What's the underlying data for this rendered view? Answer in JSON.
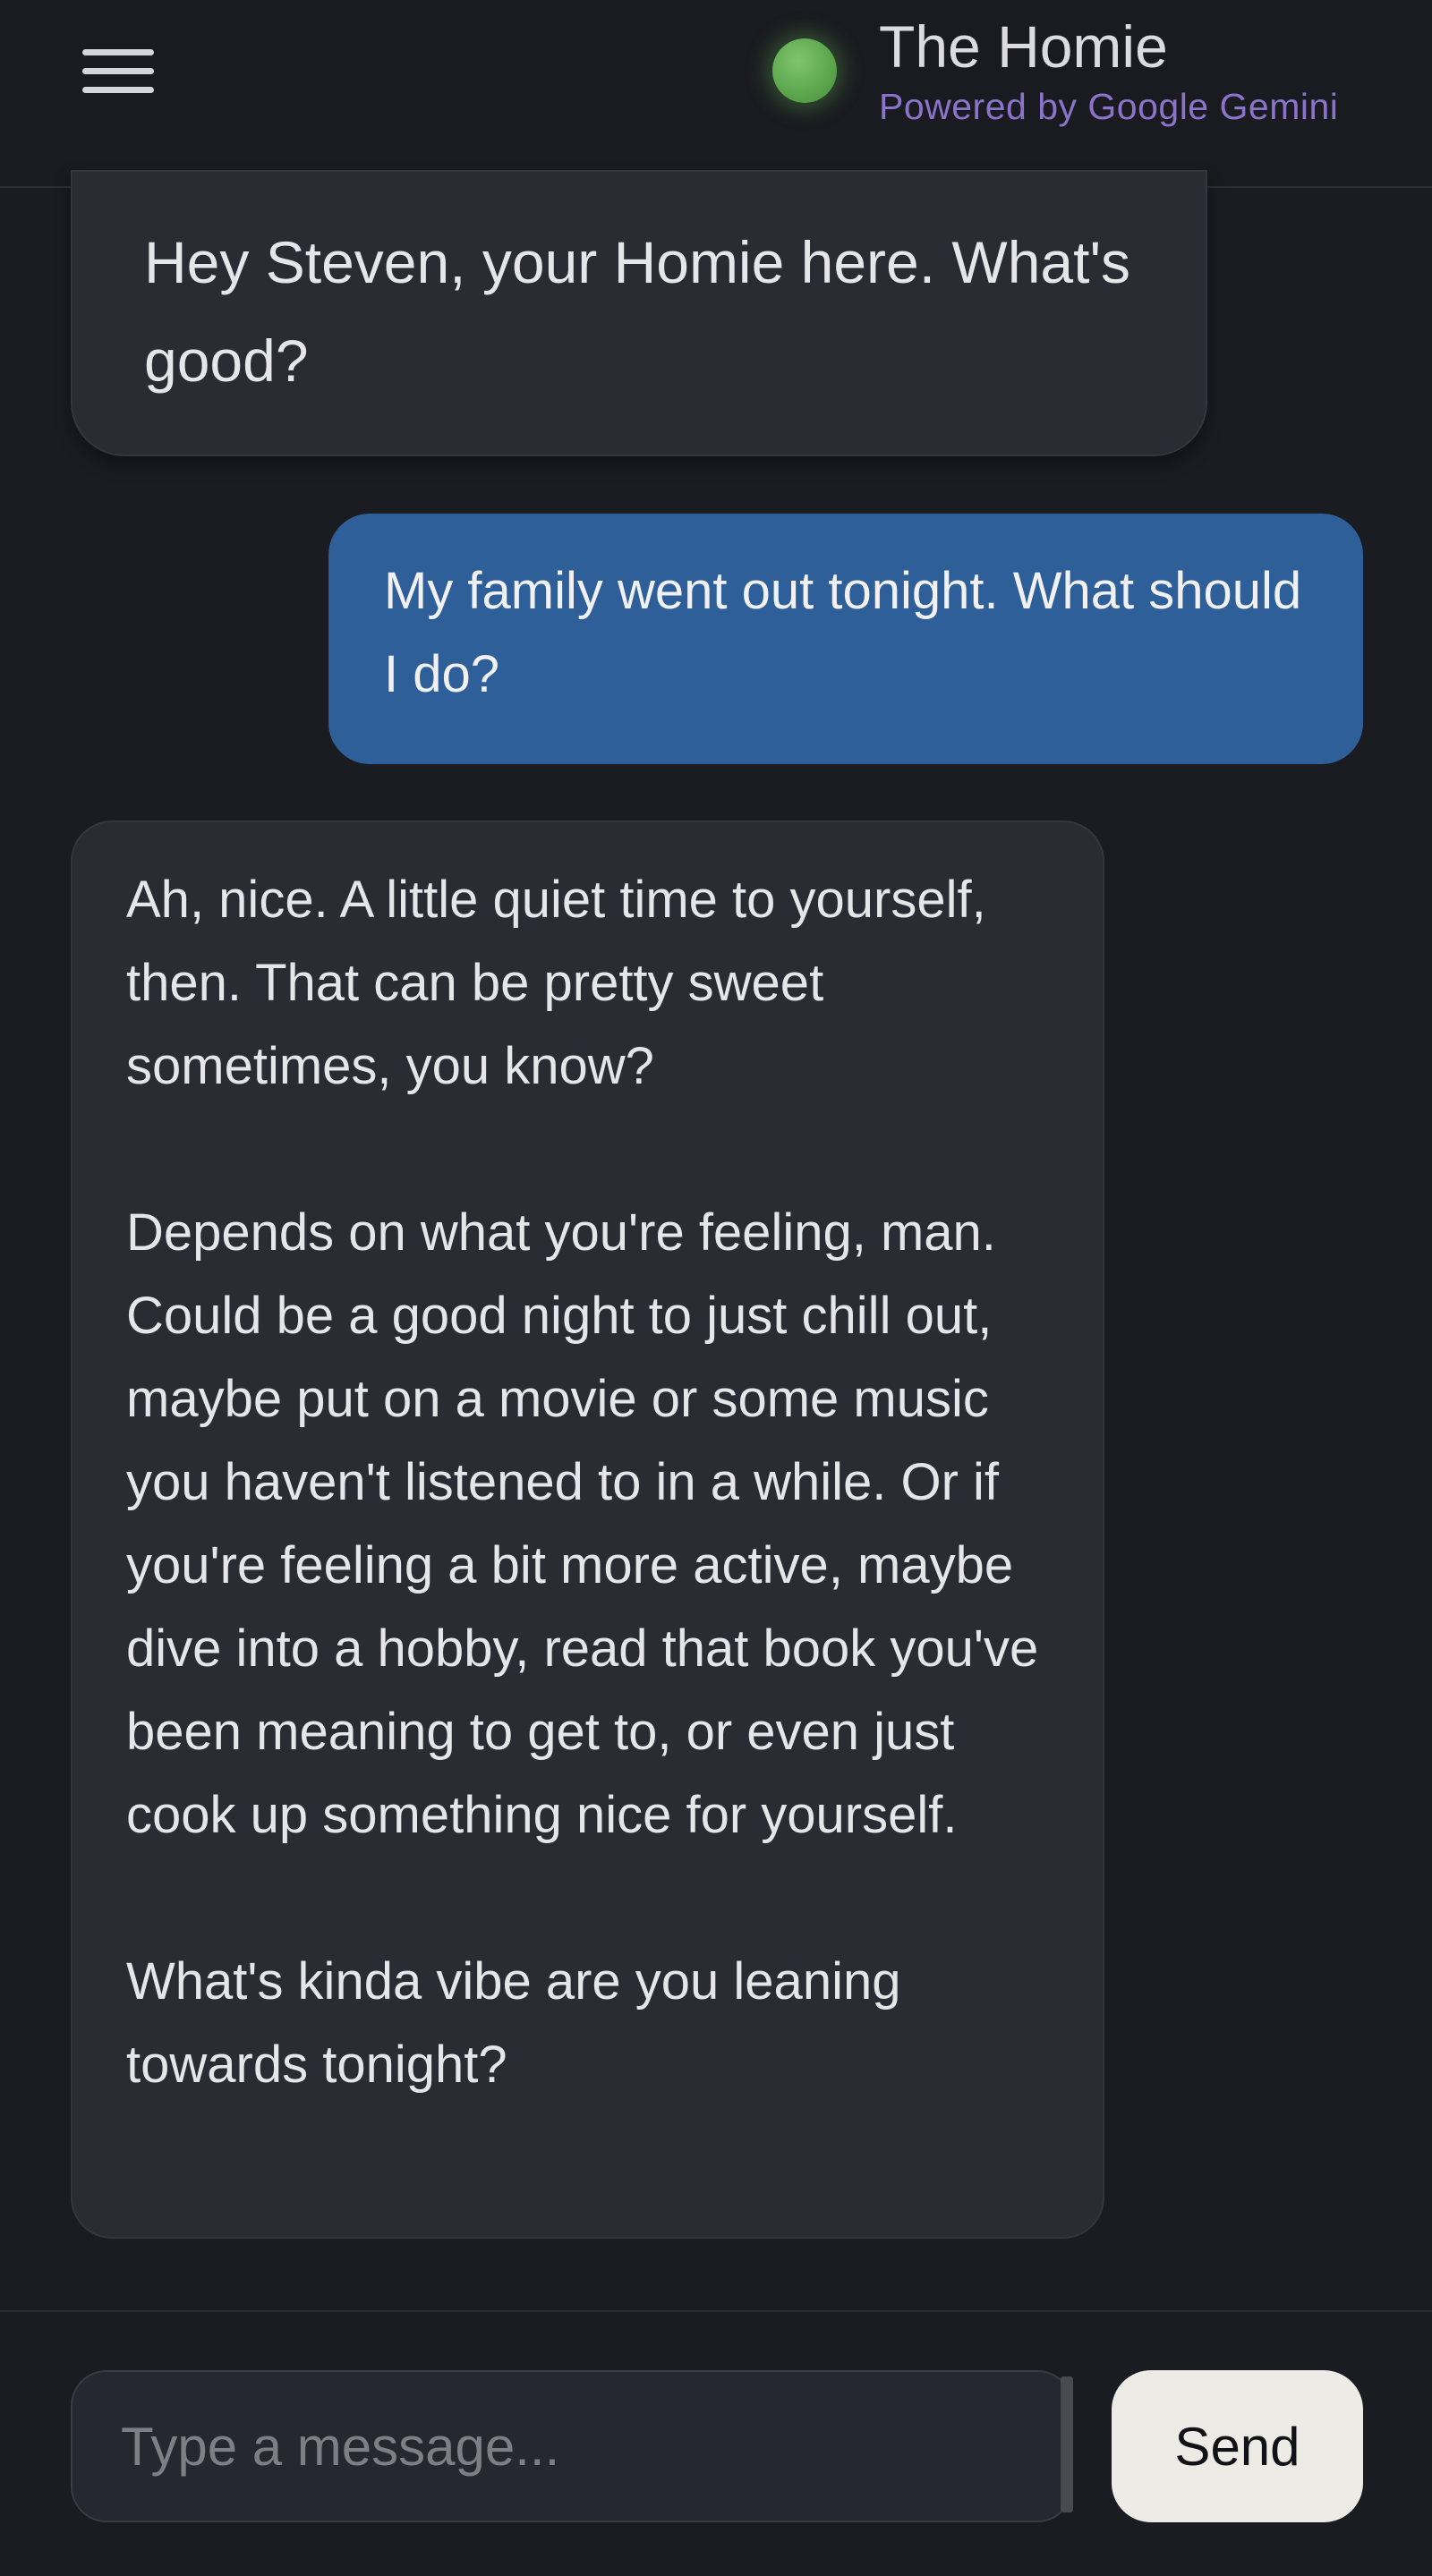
{
  "header": {
    "title": "The Homie",
    "subtitle": "Powered by Google Gemini",
    "status_color": "#5ea84e"
  },
  "messages": [
    {
      "sender": "bot",
      "text": "Hey Steven, your Homie here. What's good?"
    },
    {
      "sender": "user",
      "text": "My family went out tonight. What should I do?"
    },
    {
      "sender": "bot",
      "text": "Ah, nice. A little quiet time to yourself, then. That can be pretty sweet sometimes, you know?\n\nDepends on what you're feeling, man. Could be a good night to just chill out, maybe put on a movie or some music you haven't listened to in a while. Or if you're feeling a bit more active, maybe dive into a hobby, read that book you've been meaning to get to, or even just cook up something nice for yourself.\n\nWhat's kinda vibe are you leaning towards tonight?"
    }
  ],
  "composer": {
    "placeholder": "Type a message...",
    "value": "",
    "send_label": "Send"
  },
  "colors": {
    "background": "#1b1c22",
    "bot_bubble": "#2a2b33",
    "user_bubble": "#2e5f98",
    "subtitle": "#8a74c9",
    "send_button": "#ecebe6"
  }
}
